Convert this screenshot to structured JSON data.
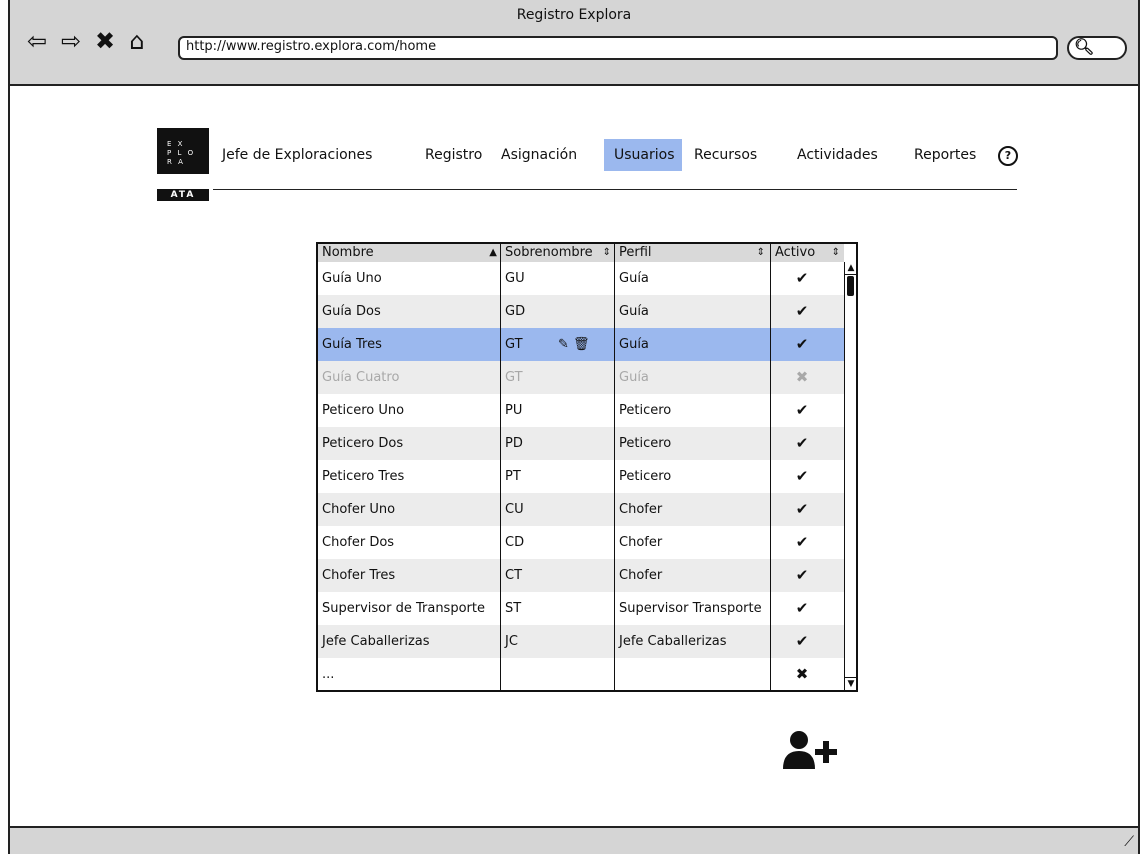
{
  "window": {
    "title": "Registro Explora",
    "url": "http://www.registro.explora.com/home"
  },
  "logo": {
    "lines": [
      "E X",
      "P L O",
      "R A"
    ],
    "badge": "ATA"
  },
  "header": {
    "brand": "Jefe de Exploraciones",
    "nav": [
      "Registro",
      "Asignación",
      "Usuarios",
      "Recursos",
      "Actividades",
      "Reportes"
    ],
    "active": "Usuarios",
    "help_icon": "question-circle-icon"
  },
  "table": {
    "columns": [
      "Nombre",
      "Sobrenombre",
      "Perfil",
      "Activo"
    ],
    "rows": [
      {
        "nombre": "Guía Uno",
        "sobrenombre": "GU",
        "perfil": "Guía",
        "activo": "✔"
      },
      {
        "nombre": "Guía Dos",
        "sobrenombre": "GD",
        "perfil": "Guía",
        "activo": "✔"
      },
      {
        "nombre": "Guía Tres",
        "sobrenombre": "GT",
        "perfil": "Guía",
        "activo": "✔"
      },
      {
        "nombre": "Guía Cuatro",
        "sobrenombre": "GT",
        "perfil": "Guía",
        "activo": "✖"
      },
      {
        "nombre": "Peticero Uno",
        "sobrenombre": "PU",
        "perfil": "Peticero",
        "activo": "✔"
      },
      {
        "nombre": "Peticero Dos",
        "sobrenombre": "PD",
        "perfil": "Peticero",
        "activo": "✔"
      },
      {
        "nombre": "Peticero Tres",
        "sobrenombre": "PT",
        "perfil": "Peticero",
        "activo": "✔"
      },
      {
        "nombre": "Chofer Uno",
        "sobrenombre": "CU",
        "perfil": "Chofer",
        "activo": "✔"
      },
      {
        "nombre": "Chofer Dos",
        "sobrenombre": "CD",
        "perfil": "Chofer",
        "activo": "✔"
      },
      {
        "nombre": "Chofer Tres",
        "sobrenombre": "CT",
        "perfil": "Chofer",
        "activo": "✔"
      },
      {
        "nombre": "Supervisor de Transporte",
        "sobrenombre": "ST",
        "perfil": "Supervisor Transporte",
        "activo": "✔"
      },
      {
        "nombre": "Jefe Caballerizas",
        "sobrenombre": "JC",
        "perfil": "Jefe Caballerizas",
        "activo": "✔"
      },
      {
        "nombre": "...",
        "sobrenombre": "",
        "perfil": "",
        "activo": "✖"
      }
    ],
    "selected_index": 2,
    "disabled_index": 3,
    "row_icons": [
      "pencil-icon",
      "trash-icon"
    ]
  },
  "colors": {
    "selected": "#9bb8ee",
    "stripe": "#ececec",
    "chrome": "#d5d5d5",
    "disabled_text": "#a8a8a8"
  },
  "add_user": {
    "icon": "add-user-icon"
  }
}
